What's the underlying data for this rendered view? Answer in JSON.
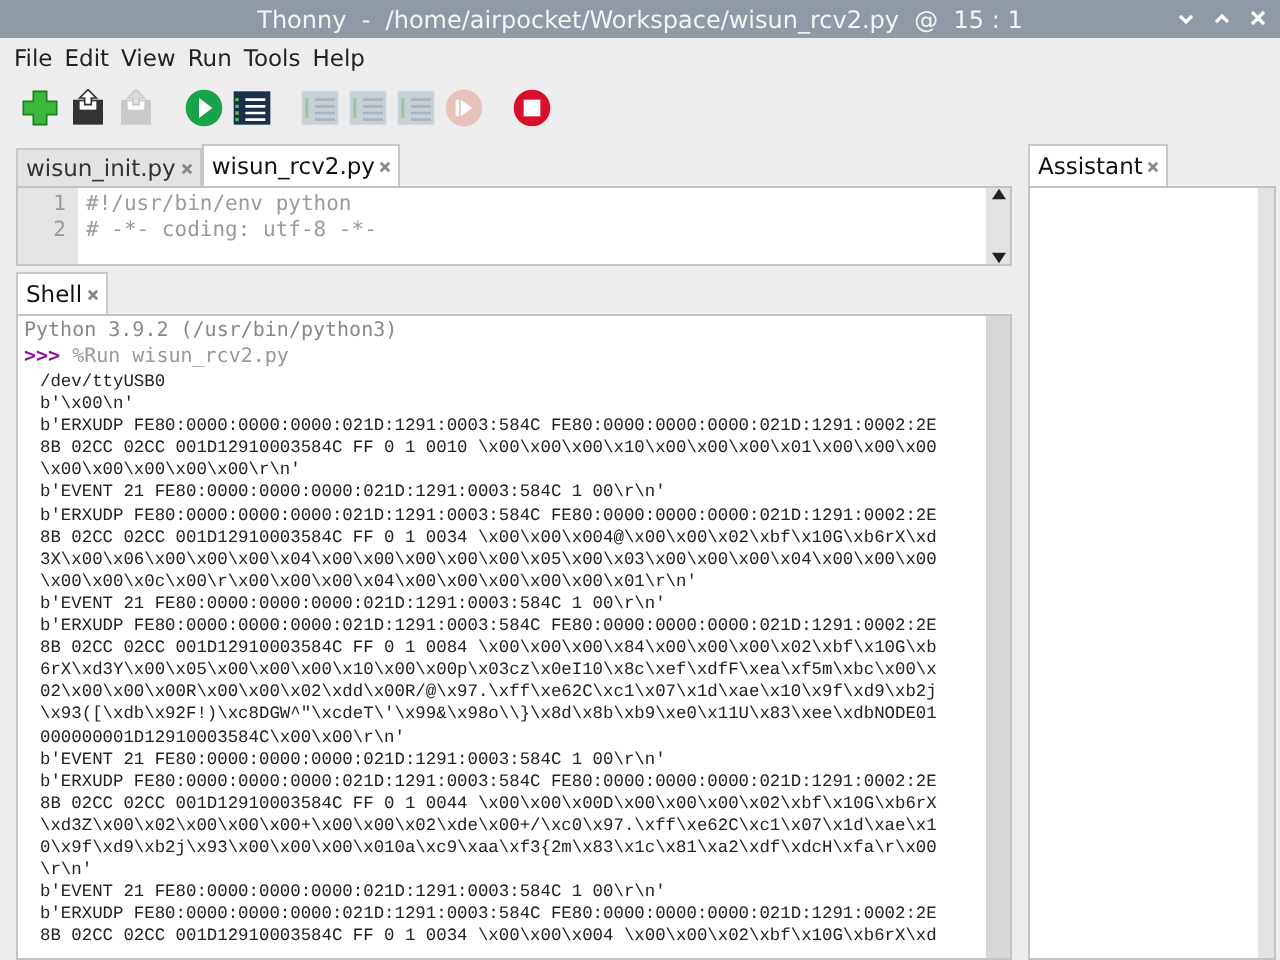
{
  "window": {
    "title": "Thonny  -  /home/airpocket/Workspace/wisun_rcv2.py  @  15 : 1"
  },
  "menu": [
    "File",
    "Edit",
    "View",
    "Run",
    "Tools",
    "Help"
  ],
  "toolbar": [
    {
      "kind": "new",
      "disabled": false
    },
    {
      "kind": "save",
      "disabled": false
    },
    {
      "kind": "save",
      "disabled": true
    },
    {
      "kind": "sep"
    },
    {
      "kind": "run",
      "disabled": false
    },
    {
      "kind": "debug",
      "disabled": false
    },
    {
      "kind": "sep"
    },
    {
      "kind": "step",
      "disabled": true
    },
    {
      "kind": "step",
      "disabled": true
    },
    {
      "kind": "step",
      "disabled": true
    },
    {
      "kind": "resume",
      "disabled": true
    },
    {
      "kind": "sep"
    },
    {
      "kind": "stop",
      "disabled": false
    }
  ],
  "editor": {
    "tabs": [
      {
        "label": "wisun_init.py",
        "selected": false
      },
      {
        "label": "wisun_rcv2.py",
        "selected": true
      }
    ],
    "lines": [
      {
        "number": "1",
        "text": "#!/usr/bin/env python"
      },
      {
        "number": "2",
        "text": "# -*- coding: utf-8 -*-"
      }
    ]
  },
  "shell": {
    "tab": {
      "label": "Shell",
      "selected": true
    },
    "banner": "Python 3.9.2 (/usr/bin/python3)",
    "prompt": ">>>",
    "command": "%Run wisun_rcv2.py",
    "output": [
      "/dev/ttyUSB0",
      "b'\\x00\\n'",
      "b'ERXUDP FE80:0000:0000:0000:021D:1291:0003:584C FE80:0000:0000:0000:021D:1291:0002:2E",
      "8B 02CC 02CC 001D12910003584C FF 0 1 0010 \\x00\\x00\\x00\\x10\\x00\\x00\\x00\\x01\\x00\\x00\\x00",
      "\\x00\\x00\\x00\\x00\\x00\\r\\n'",
      "b'EVENT 21 FE80:0000:0000:0000:021D:1291:0003:584C 1 00\\r\\n'",
      "b'ERXUDP FE80:0000:0000:0000:021D:1291:0003:584C FE80:0000:0000:0000:021D:1291:0002:2E",
      "8B 02CC 02CC 001D12910003584C FF 0 1 0034 \\x00\\x00\\x004@\\x00\\x00\\x02\\xbf\\x10G\\xb6rX\\xd",
      "3X\\x00\\x06\\x00\\x00\\x00\\x04\\x00\\x00\\x00\\x00\\x00\\x05\\x00\\x03\\x00\\x00\\x00\\x04\\x00\\x00\\x00",
      "\\x00\\x00\\x0c\\x00\\r\\x00\\x00\\x00\\x04\\x00\\x00\\x00\\x00\\x00\\x01\\r\\n'",
      "b'EVENT 21 FE80:0000:0000:0000:021D:1291:0003:584C 1 00\\r\\n'",
      "b'ERXUDP FE80:0000:0000:0000:021D:1291:0003:584C FE80:0000:0000:0000:021D:1291:0002:2E",
      "8B 02CC 02CC 001D12910003584C FF 0 1 0084 \\x00\\x00\\x00\\x84\\x00\\x00\\x00\\x02\\xbf\\x10G\\xb",
      "6rX\\xd3Y\\x00\\x05\\x00\\x00\\x00\\x10\\x00\\x00p\\x03cz\\x0eI10\\x8c\\xef\\xdfF\\xea\\xf5m\\xbc\\x00\\x",
      "02\\x00\\x00\\x00R\\x00\\x00\\x02\\xdd\\x00R/@\\x97.\\xff\\xe62C\\xc1\\x07\\x1d\\xae\\x10\\x9f\\xd9\\xb2j",
      "\\x93([\\xdb\\x92F!)\\xc8DGW^\"\\xcdeT\\'\\x99&\\x98o\\\\}\\x8d\\x8b\\xb9\\xe0\\x11U\\x83\\xee\\xdbNODE01",
      "000000001D12910003584C\\x00\\x00\\r\\n'",
      "b'EVENT 21 FE80:0000:0000:0000:021D:1291:0003:584C 1 00\\r\\n'",
      "b'ERXUDP FE80:0000:0000:0000:021D:1291:0003:584C FE80:0000:0000:0000:021D:1291:0002:2E",
      "8B 02CC 02CC 001D12910003584C FF 0 1 0044 \\x00\\x00\\x00D\\x00\\x00\\x00\\x02\\xbf\\x10G\\xb6rX",
      "\\xd3Z\\x00\\x02\\x00\\x00\\x00+\\x00\\x00\\x02\\xde\\x00+/\\xc0\\x97.\\xff\\xe62C\\xc1\\x07\\x1d\\xae\\x1",
      "0\\x9f\\xd9\\xb2j\\x93\\x00\\x00\\x00\\x010a\\xc9\\xaa\\xf3{2m\\x83\\x1c\\x81\\xa2\\xdf\\xdcH\\xfa\\r\\x00",
      "\\r\\n'",
      "b'EVENT 21 FE80:0000:0000:0000:021D:1291:0003:584C 1 00\\r\\n'",
      "b'ERXUDP FE80:0000:0000:0000:021D:1291:0003:584C FE80:0000:0000:0000:021D:1291:0002:2E",
      "8B 02CC 02CC 001D12910003584C FF 0 1 0034 \\x00\\x00\\x004 \\x00\\x00\\x02\\xbf\\x10G\\xb6rX\\xd"
    ]
  },
  "assistant": {
    "tab": {
      "label": "Assistant",
      "selected": true
    }
  }
}
